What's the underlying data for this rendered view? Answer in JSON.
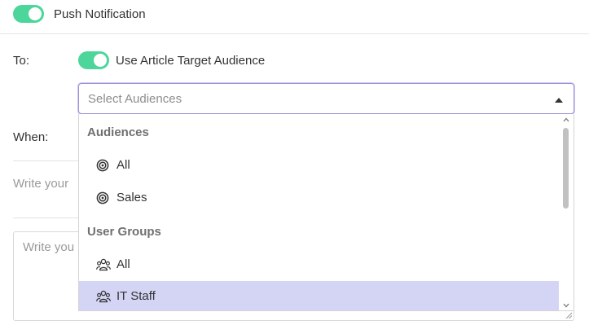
{
  "header": {
    "push_notification_label": "Push Notification",
    "push_enabled": true
  },
  "to": {
    "label": "To:",
    "use_article_audience_label": "Use Article Target Audience",
    "use_article_audience_enabled": true
  },
  "select": {
    "placeholder": "Select Audiences"
  },
  "when": {
    "label": "When:"
  },
  "title_field": {
    "placeholder_visible": "Write your"
  },
  "message_field": {
    "placeholder_visible": "Write you"
  },
  "dropdown": {
    "groups": [
      {
        "label": "Audiences",
        "options": [
          {
            "label": "All",
            "icon": "target-icon"
          },
          {
            "label": "Sales",
            "icon": "target-icon"
          }
        ]
      },
      {
        "label": "User Groups",
        "options": [
          {
            "label": "All",
            "icon": "users-icon"
          },
          {
            "label": "IT Staff",
            "icon": "users-icon",
            "selected": true
          }
        ]
      }
    ]
  },
  "colors": {
    "toggle_on": "#4cd69b",
    "select_border": "#9d92d8",
    "selected_option_bg": "#d4d4f5"
  }
}
